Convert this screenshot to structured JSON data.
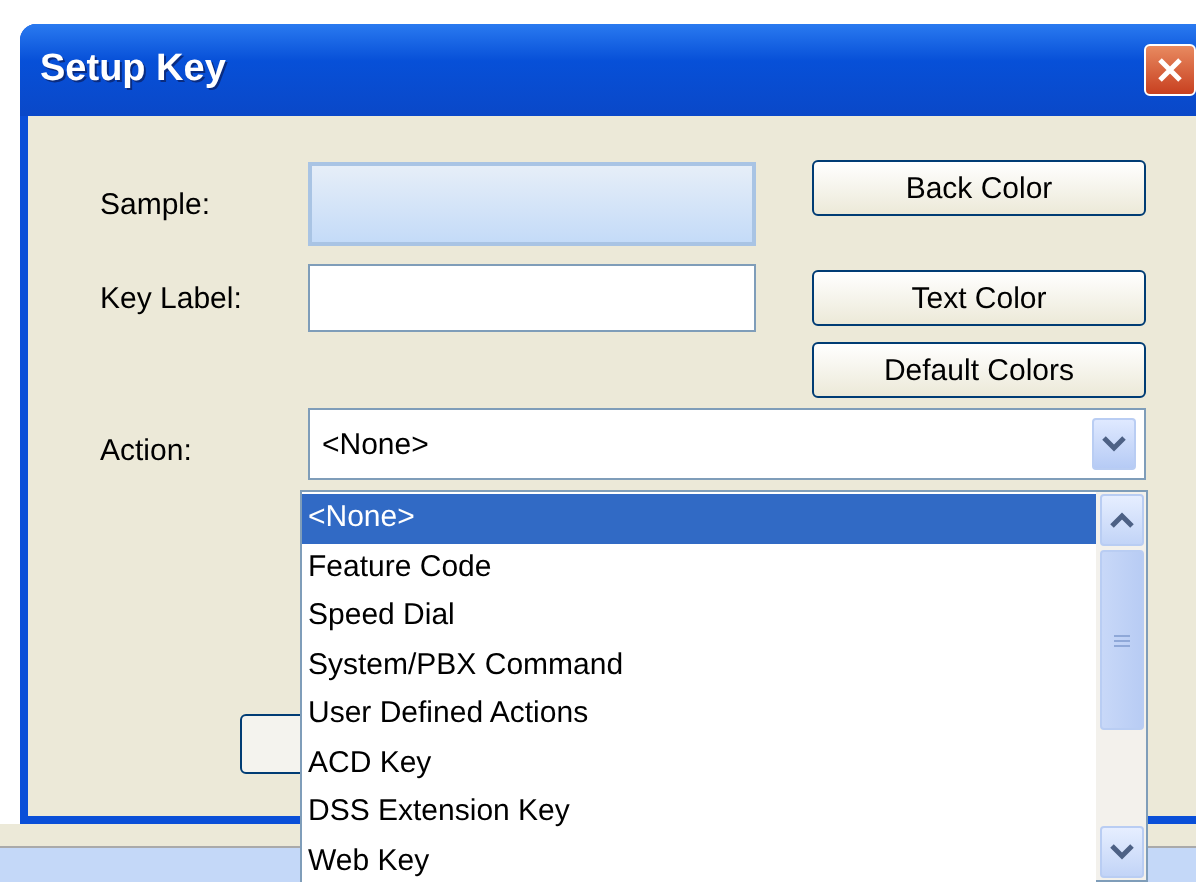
{
  "window": {
    "title": "Setup Key"
  },
  "fields": [
    {
      "label": "Sample:",
      "kind": "sample"
    },
    {
      "label": "Key Label:",
      "kind": "input"
    }
  ],
  "buttons": [
    "Back Color",
    "Text Color",
    "Default Colors"
  ],
  "action": {
    "label": "Action:",
    "value": "<None>"
  },
  "dropdown": [
    {
      "label": "<None>",
      "selected": true
    },
    {
      "label": "Feature Code",
      "selected": false
    },
    {
      "label": "Speed Dial",
      "selected": false
    },
    {
      "label": "System/PBX Command",
      "selected": false
    },
    {
      "label": "User Defined Actions",
      "selected": false
    },
    {
      "label": "ACD Key",
      "selected": false
    },
    {
      "label": "DSS Extension Key",
      "selected": false
    },
    {
      "label": "Web Key",
      "selected": false
    }
  ]
}
